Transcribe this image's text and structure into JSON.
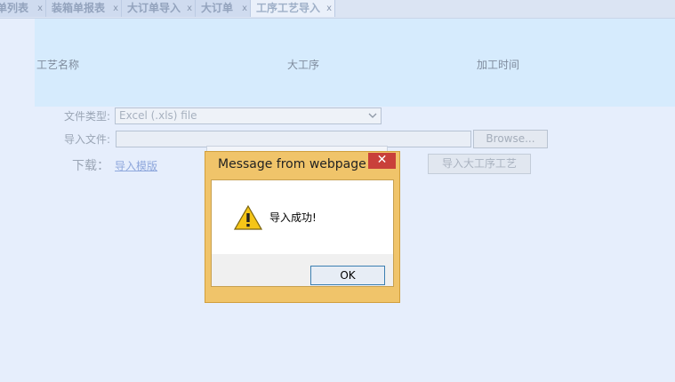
{
  "tabs": [
    {
      "label": "单列表",
      "close": "x"
    },
    {
      "label": "装箱单报表",
      "close": "x"
    },
    {
      "label": "大订单导入",
      "close": "x"
    },
    {
      "label": "大订单",
      "close": "x"
    },
    {
      "label": "工序工艺导入",
      "close": "x",
      "active": true
    }
  ],
  "grid": {
    "columns": [
      "工艺名称",
      "大工序",
      "加工时间"
    ]
  },
  "form": {
    "file_type_label": "文件类型:",
    "file_type_value": "Excel (.xls) file",
    "import_file_label": "导入文件:",
    "browse_label": "Browse...",
    "download_label": "下载：",
    "template_link": "导入模版",
    "import_button": "导入大工序工艺"
  },
  "dialog": {
    "title": "Message from webpage",
    "close_glyph": "✕",
    "message": "导入成功!",
    "ok_label": "OK",
    "icon": "warning-icon"
  },
  "colors": {
    "dialog_frame": "#f0c46a",
    "close_button": "#c9403a",
    "grid_header": "#d6ebfd",
    "page_background": "#e6eefc"
  }
}
